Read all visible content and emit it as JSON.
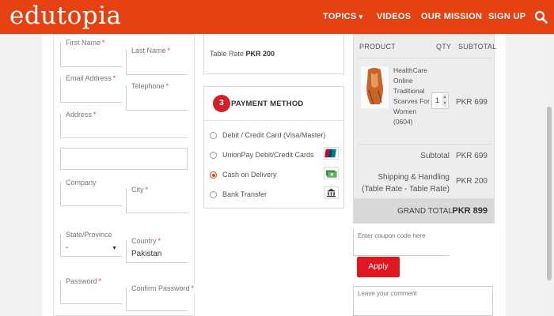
{
  "header": {
    "logo": "edutopia",
    "nav": [
      "TOPICS",
      "VIDEOS",
      "OUR MISSION",
      "SIGN UP"
    ],
    "nav_caret": "▾",
    "search_icon": "search-icon"
  },
  "form": {
    "required_mark": "*",
    "first_name_label": "First Name",
    "last_name_label": "Last Name",
    "email_label": "Email Address",
    "telephone_label": "Telephone",
    "address_label": "Address",
    "company_label": "Company",
    "city_label": "City",
    "state_label": "State/Province",
    "state_value": "-",
    "country_label": "Country",
    "country_value": "Pakistan",
    "password_label": "Password",
    "confirm_password_label": "Confirm Password",
    "select_caret": "▼"
  },
  "shipping": {
    "rate_prefix": "Table Rate",
    "rate_amount": "PKR 200"
  },
  "payment": {
    "step": "3",
    "title": "PAYMENT METHOD",
    "options": [
      {
        "label": "Debit / Credit Card (Visa/Master)",
        "checked": false,
        "icon": ""
      },
      {
        "label": "UnionPay Debit/Credit Cards",
        "checked": false,
        "icon": "unionpay-icon"
      },
      {
        "label": "Cash on Delivery",
        "checked": true,
        "icon": "cash-icon"
      },
      {
        "label": "Bank Transfer",
        "checked": false,
        "icon": "bank-icon"
      }
    ]
  },
  "cart": {
    "col_product": "PRODUCT",
    "col_qty": "QTY",
    "col_subtotal": "SUBTOTAL",
    "item": {
      "name": "HealthCare Online Traditional Scarves For Women (0604)",
      "qty": "1",
      "price": "PKR 699"
    },
    "subtotal_label": "Subtotal",
    "subtotal_value": "PKR 699",
    "shipping_label": "Shipping & Handling (Table Rate - Table Rate)",
    "shipping_value": "PKR 200",
    "grand_label": "GRAND TOTAL",
    "grand_value": "PKR 899"
  },
  "coupon": {
    "placeholder": "Enter coupon code here",
    "apply_label": "Apply"
  },
  "comment": {
    "placeholder": "Leave your comment"
  },
  "colors": {
    "brand": "#e64112",
    "button": "#e0171f"
  }
}
